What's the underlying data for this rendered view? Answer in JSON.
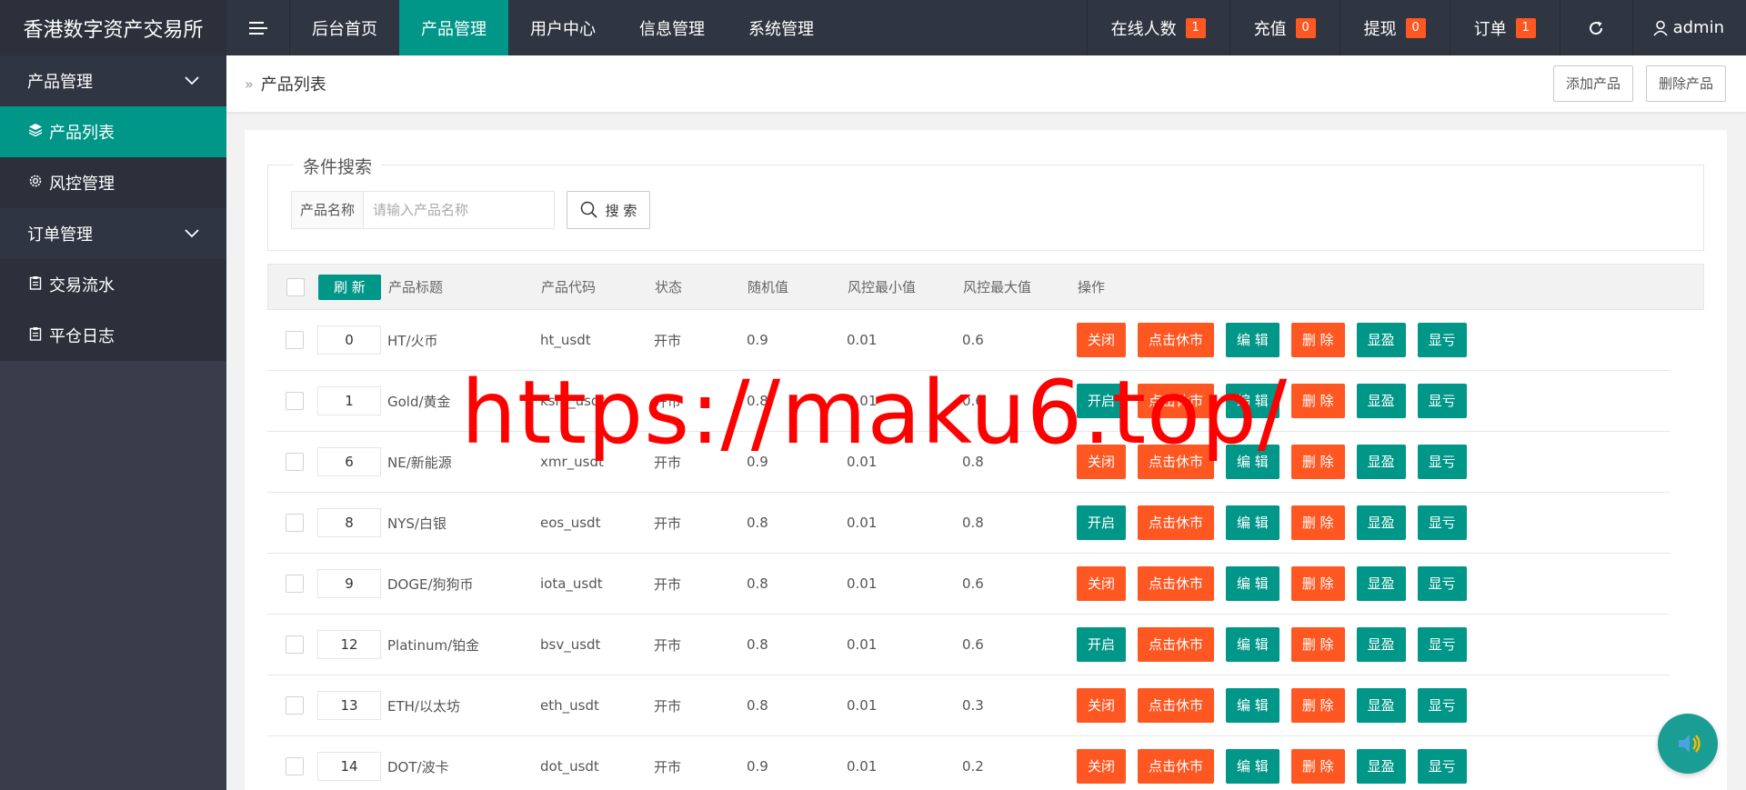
{
  "app": {
    "title": "香港数字资产交易所"
  },
  "topnav": {
    "items": [
      {
        "label": "后台首页",
        "active": false
      },
      {
        "label": "产品管理",
        "active": true
      },
      {
        "label": "用户中心",
        "active": false
      },
      {
        "label": "信息管理",
        "active": false
      },
      {
        "label": "系统管理",
        "active": false
      }
    ],
    "stats": [
      {
        "label": "在线人数",
        "count": "1"
      },
      {
        "label": "充值",
        "count": "0"
      },
      {
        "label": "提现",
        "count": "0"
      },
      {
        "label": "订单",
        "count": "1"
      }
    ],
    "user": "admin"
  },
  "sidebar": {
    "groups": [
      {
        "label": "产品管理",
        "items": [
          {
            "label": "产品列表",
            "icon": "layers-icon",
            "active": true
          },
          {
            "label": "风控管理",
            "icon": "gear-icon",
            "active": false
          }
        ]
      },
      {
        "label": "订单管理",
        "items": [
          {
            "label": "交易流水",
            "icon": "clipboard-icon",
            "active": false
          },
          {
            "label": "平仓日志",
            "icon": "clipboard-icon",
            "active": false
          }
        ]
      }
    ]
  },
  "breadcrumb": {
    "current": "产品列表",
    "add_label": "添加产品",
    "delete_label": "删除产品"
  },
  "search": {
    "legend": "条件搜索",
    "label": "产品名称",
    "placeholder": "请输入产品名称",
    "value": "",
    "button": "搜 索"
  },
  "table": {
    "refresh_label": "刷 新",
    "columns": [
      "产品标题",
      "产品代码",
      "状态",
      "随机值",
      "风控最小值",
      "风控最大值",
      "操作"
    ],
    "op_labels": {
      "close": "关闭",
      "open": "开启",
      "rest": "点击休市",
      "edit": "编 辑",
      "delete": "删 除",
      "profit": "显盈",
      "loss": "显亏"
    },
    "rows": [
      {
        "sort": "0",
        "title": "HT/火币",
        "code": "ht_usdt",
        "status": "开市",
        "random": "0.9",
        "min": "0.01",
        "max": "0.6",
        "toggle": "close"
      },
      {
        "sort": "1",
        "title": "Gold/黄金",
        "code": "ksm_usdt",
        "status": "开市",
        "random": "0.8",
        "min": "0.01",
        "max": "0.6",
        "toggle": "open"
      },
      {
        "sort": "6",
        "title": "NE/新能源",
        "code": "xmr_usdt",
        "status": "开市",
        "random": "0.9",
        "min": "0.01",
        "max": "0.8",
        "toggle": "close"
      },
      {
        "sort": "8",
        "title": "NYS/白银",
        "code": "eos_usdt",
        "status": "开市",
        "random": "0.8",
        "min": "0.01",
        "max": "0.8",
        "toggle": "open"
      },
      {
        "sort": "9",
        "title": "DOGE/狗狗币",
        "code": "iota_usdt",
        "status": "开市",
        "random": "0.8",
        "min": "0.01",
        "max": "0.6",
        "toggle": "close"
      },
      {
        "sort": "12",
        "title": "Platinum/铂金",
        "code": "bsv_usdt",
        "status": "开市",
        "random": "0.8",
        "min": "0.01",
        "max": "0.6",
        "toggle": "open"
      },
      {
        "sort": "13",
        "title": "ETH/以太坊",
        "code": "eth_usdt",
        "status": "开市",
        "random": "0.8",
        "min": "0.01",
        "max": "0.3",
        "toggle": "close"
      },
      {
        "sort": "14",
        "title": "DOT/波卡",
        "code": "dot_usdt",
        "status": "开市",
        "random": "0.9",
        "min": "0.01",
        "max": "0.2",
        "toggle": "close"
      }
    ]
  },
  "watermark": "https://maku6.top/",
  "colors": {
    "accent": "#009688",
    "danger": "#ff5722",
    "topbar": "#2f3541",
    "sidebar": "#393d49"
  }
}
